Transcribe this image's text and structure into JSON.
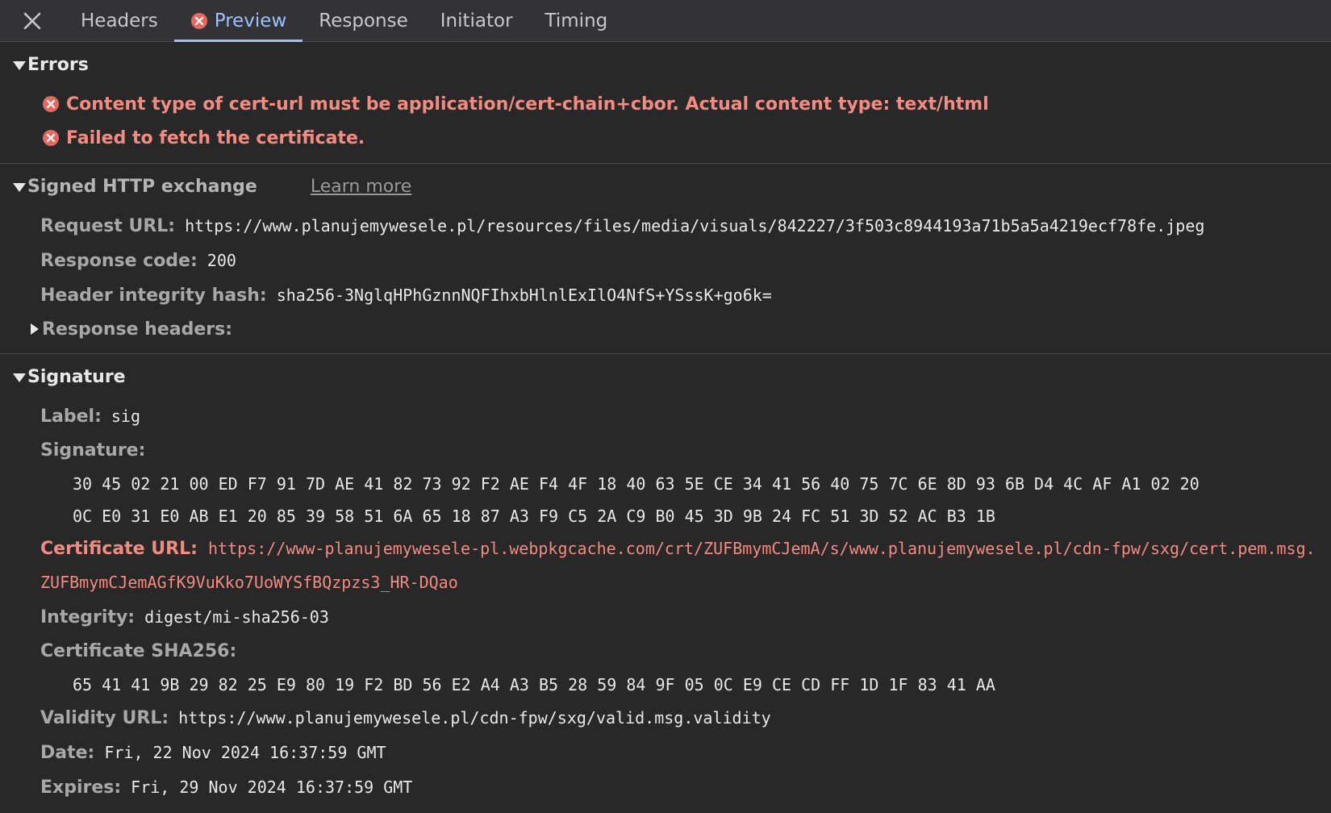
{
  "tabs": [
    {
      "label": "Headers"
    },
    {
      "label": "Preview"
    },
    {
      "label": "Response"
    },
    {
      "label": "Initiator"
    },
    {
      "label": "Timing"
    }
  ],
  "colors": {
    "accent": "#9dc2ff",
    "error": "#f28b82",
    "background": "#282828"
  },
  "errors": {
    "title": "Errors",
    "items": [
      "Content type of cert-url must be application/cert-chain+cbor. Actual content type: text/html",
      "Failed to fetch the certificate."
    ]
  },
  "exchange": {
    "title": "Signed HTTP exchange",
    "learn_more": "Learn more",
    "request_url_label": "Request URL:",
    "request_url": "https://www.planujemywesele.pl/resources/files/media/visuals/842227/3f503c8944193a71b5a5a4219ecf78fe.jpeg",
    "response_code_label": "Response code:",
    "response_code": "200",
    "header_hash_label": "Header integrity hash:",
    "header_hash": "sha256-3NglqHPhGznnNQFIhxbHlnlExIlO4NfS+YSssK+go6k=",
    "response_headers_label": "Response headers:"
  },
  "signature": {
    "title": "Signature",
    "label_label": "Label:",
    "label": "sig",
    "signature_label": "Signature:",
    "signature_hex": [
      "30 45 02 21 00 ED F7 91 7D AE 41 82 73 92 F2 AE F4 4F 18 40 63 5E CE 34 41 56 40 75 7C 6E 8D 93 6B D4 4C AF A1 02 20",
      "0C E0 31 E0 AB E1 20 85 39 58 51 6A 65 18 87 A3 F9 C5 2A C9 B0 45 3D 9B 24 FC 51 3D 52 AC B3 1B"
    ],
    "cert_url_label": "Certificate URL:",
    "cert_url": "https://www-planujemywesele-pl.webpkgcache.com/crt/ZUFBmymCJemA/s/www.planujemywesele.pl/cdn-fpw/sxg/cert.pem.msg.ZUFBmymCJemAGfK9VuKko7UoWYSfBQzpzs3_HR-DQao",
    "integrity_label": "Integrity:",
    "integrity": "digest/mi-sha256-03",
    "cert_sha_label": "Certificate SHA256:",
    "cert_sha_hex": "65 41 41 9B 29 82 25 E9 80 19 F2 BD 56 E2 A4 A3 B5 28 59 84 9F 05 0C E9 CE CD FF 1D 1F 83 41 AA",
    "validity_label": "Validity URL:",
    "validity_url": "https://www.planujemywesele.pl/cdn-fpw/sxg/valid.msg.validity",
    "date_label": "Date:",
    "date": "Fri, 22 Nov 2024 16:37:59 GMT",
    "expires_label": "Expires:",
    "expires": "Fri, 29 Nov 2024 16:37:59 GMT"
  }
}
